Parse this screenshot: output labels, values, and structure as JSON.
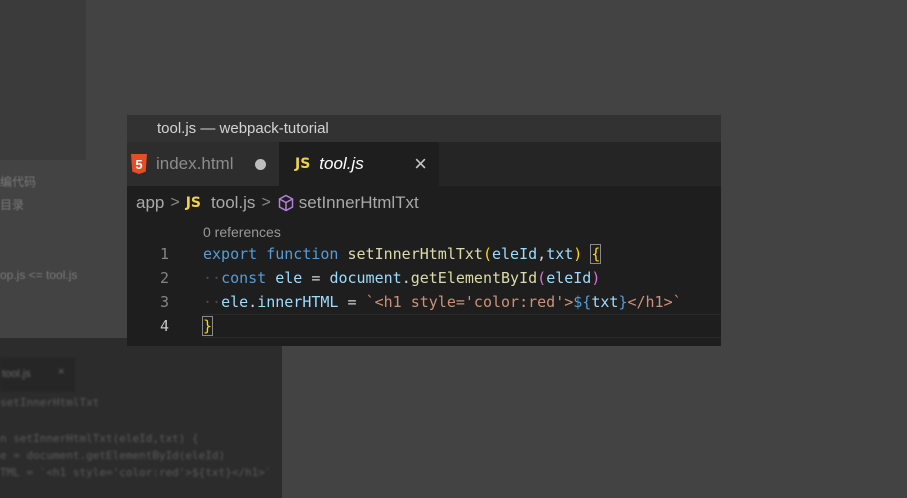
{
  "background": {
    "texts": [
      "编代码",
      "目录",
      "op.js <= tool.js"
    ],
    "bottom_tab": "tool.js",
    "bottom_tab_close": "×",
    "bottom_lines": [
      "setInnerHtmlTxt",
      "n setInnerHtmlTxt(eleId,txt) {",
      "e = document.getElementById(eleId)",
      "TML = `<h1 style='color:red'>${txt}</h1>`"
    ]
  },
  "window": {
    "title": "tool.js — webpack-tutorial"
  },
  "tabs": [
    {
      "label": "index.html",
      "icon": "html5-icon",
      "icon_text": "5",
      "modified": true
    },
    {
      "label": "tool.js",
      "icon": "js-icon",
      "icon_text": "JS",
      "close": "×"
    }
  ],
  "breadcrumb": {
    "folder": "app",
    "file_icon_text": "JS",
    "file": "tool.js",
    "symbol": "setInnerHtmlTxt",
    "separator": ">"
  },
  "codelens": "0 references",
  "code": {
    "line_numbers": [
      "1",
      "2",
      "3",
      "4"
    ],
    "l1": {
      "export": "export",
      "function": "function",
      "name": "setInnerHtmlTxt",
      "open": "(",
      "p1": "eleId",
      "comma": ",",
      "p2": "txt",
      "close": ")",
      "brace": "{"
    },
    "l2": {
      "indent": "··",
      "const": "const",
      "var": "ele",
      "eq": "=",
      "obj": "document",
      "dot": ".",
      "method": "getElementById",
      "open": "(",
      "arg": "eleId",
      "close": ")"
    },
    "l3": {
      "indent": "··",
      "obj": "ele",
      "dot": ".",
      "prop": "innerHTML",
      "eq": "=",
      "tick": "`",
      "str": "<h1 style='color:red'>",
      "interp_open": "${",
      "interp_var": "txt",
      "interp_close": "}",
      "str2": "</h1>",
      "tick2": "`"
    },
    "l4": {
      "brace": "}"
    }
  },
  "colors": {
    "keyword": "#569cd6",
    "function": "#dcdcaa",
    "variable": "#9cdcfe",
    "string": "#ce9178",
    "bracket_gold": "#ffd700",
    "bracket_purple": "#da70d6",
    "js_icon": "#f1d14b",
    "html_icon": "#e44d26"
  }
}
